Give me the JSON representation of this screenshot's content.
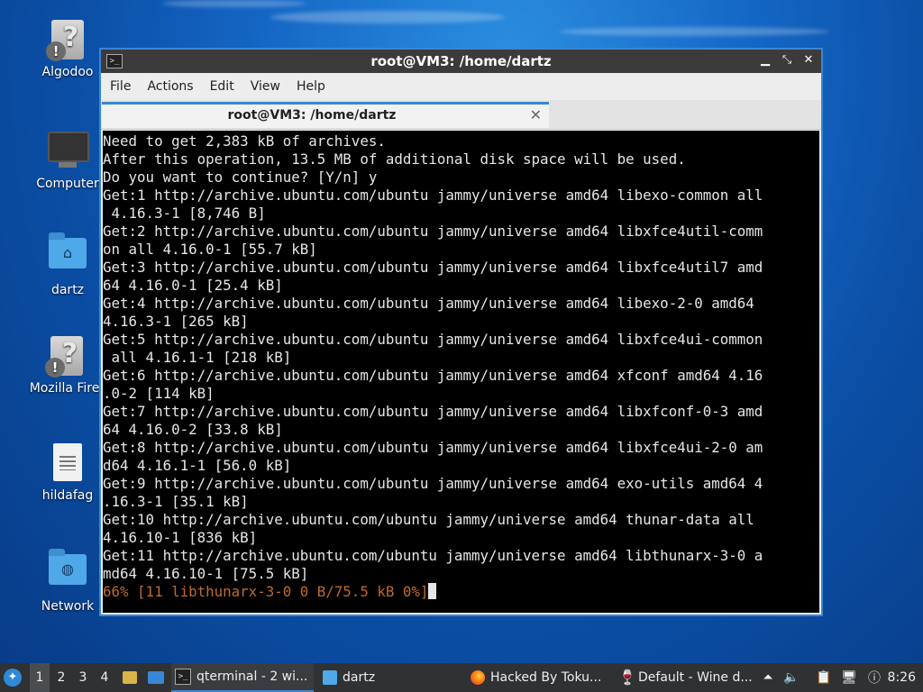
{
  "desktop": {
    "icons": [
      {
        "label": "Algodoo",
        "type": "unknown"
      },
      {
        "label": "Computer",
        "type": "computer"
      },
      {
        "label": "dartz",
        "type": "home-folder"
      },
      {
        "label": "Mozilla Firef",
        "type": "unknown"
      },
      {
        "label": "hildafag",
        "type": "text-file"
      },
      {
        "label": "Network",
        "type": "network-folder"
      }
    ]
  },
  "window": {
    "title": "root@VM3: /home/dartz",
    "controls": {
      "minimize": "▁",
      "maximize": "⤡",
      "close": "✕"
    },
    "menu": [
      "File",
      "Actions",
      "Edit",
      "View",
      "Help"
    ],
    "tab": {
      "title": "root@VM3: /home/dartz",
      "close": "✕"
    }
  },
  "terminal": {
    "lines": [
      "Need to get 2,383 kB of archives.",
      "After this operation, 13.5 MB of additional disk space will be used.",
      "Do you want to continue? [Y/n] y",
      "Get:1 http://archive.ubuntu.com/ubuntu jammy/universe amd64 libexo-common all",
      " 4.16.3-1 [8,746 B]",
      "Get:2 http://archive.ubuntu.com/ubuntu jammy/universe amd64 libxfce4util-comm",
      "on all 4.16.0-1 [55.7 kB]",
      "Get:3 http://archive.ubuntu.com/ubuntu jammy/universe amd64 libxfce4util7 amd",
      "64 4.16.0-1 [25.4 kB]",
      "Get:4 http://archive.ubuntu.com/ubuntu jammy/universe amd64 libexo-2-0 amd64",
      "4.16.3-1 [265 kB]",
      "Get:5 http://archive.ubuntu.com/ubuntu jammy/universe amd64 libxfce4ui-common",
      " all 4.16.1-1 [218 kB]",
      "Get:6 http://archive.ubuntu.com/ubuntu jammy/universe amd64 xfconf amd64 4.16",
      ".0-2 [114 kB]",
      "Get:7 http://archive.ubuntu.com/ubuntu jammy/universe amd64 libxfconf-0-3 amd",
      "64 4.16.0-2 [33.8 kB]",
      "Get:8 http://archive.ubuntu.com/ubuntu jammy/universe amd64 libxfce4ui-2-0 am",
      "d64 4.16.1-1 [56.0 kB]",
      "Get:9 http://archive.ubuntu.com/ubuntu jammy/universe amd64 exo-utils amd64 4",
      ".16.3-1 [35.1 kB]",
      "Get:10 http://archive.ubuntu.com/ubuntu jammy/universe amd64 thunar-data all",
      "4.16.10-1 [836 kB]",
      "Get:11 http://archive.ubuntu.com/ubuntu jammy/universe amd64 libthunarx-3-0 a",
      "md64 4.16.10-1 [75.5 kB]"
    ],
    "progress_line": "66% [11 libthunarx-3-0 0 B/75.5 kB 0%]",
    "progress_color": "#c06a2a"
  },
  "taskbar": {
    "workspaces": [
      "1",
      "2",
      "3",
      "4"
    ],
    "active_workspace": "1",
    "apps": [
      {
        "label": "qterminal - 2 wi...",
        "icon": "terminal-icon",
        "active": true
      },
      {
        "label": "dartz",
        "icon": "folder-icon",
        "active": false
      },
      {
        "label": "Hacked By Toku...",
        "icon": "firefox-icon",
        "active": false
      },
      {
        "label": "Default - Wine d...",
        "icon": "wine-icon",
        "active": false
      }
    ],
    "clock": "8:26"
  },
  "colors": {
    "accent": "#3a86d6",
    "taskbar": "#2f3133",
    "titlebar": "#3b3b3b"
  }
}
